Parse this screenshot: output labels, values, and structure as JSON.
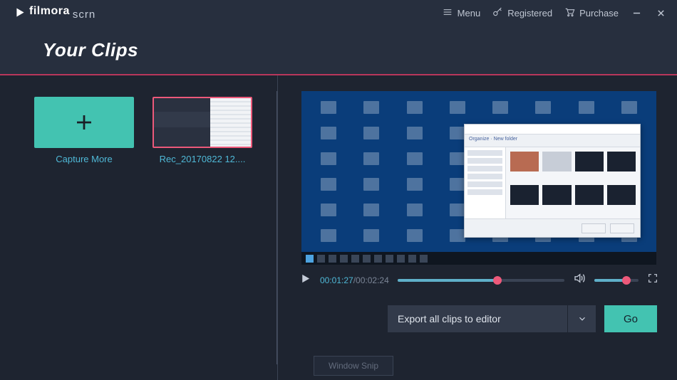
{
  "brand": {
    "name": "filmora",
    "suffix": "scrn"
  },
  "titlebar": {
    "menu": "Menu",
    "registered": "Registered",
    "purchase": "Purchase"
  },
  "section": {
    "title": "Your Clips"
  },
  "clips": {
    "capture_label": "Capture More",
    "items": [
      {
        "label": "Rec_20170822 12...."
      }
    ]
  },
  "player": {
    "current_time": "00:01:27",
    "duration": "/00:02:24",
    "seek_percent": 60,
    "volume_percent": 72
  },
  "export": {
    "selected": "Export all clips to editor",
    "go": "Go"
  },
  "overlay": {
    "window_snip": "Window Snip"
  }
}
